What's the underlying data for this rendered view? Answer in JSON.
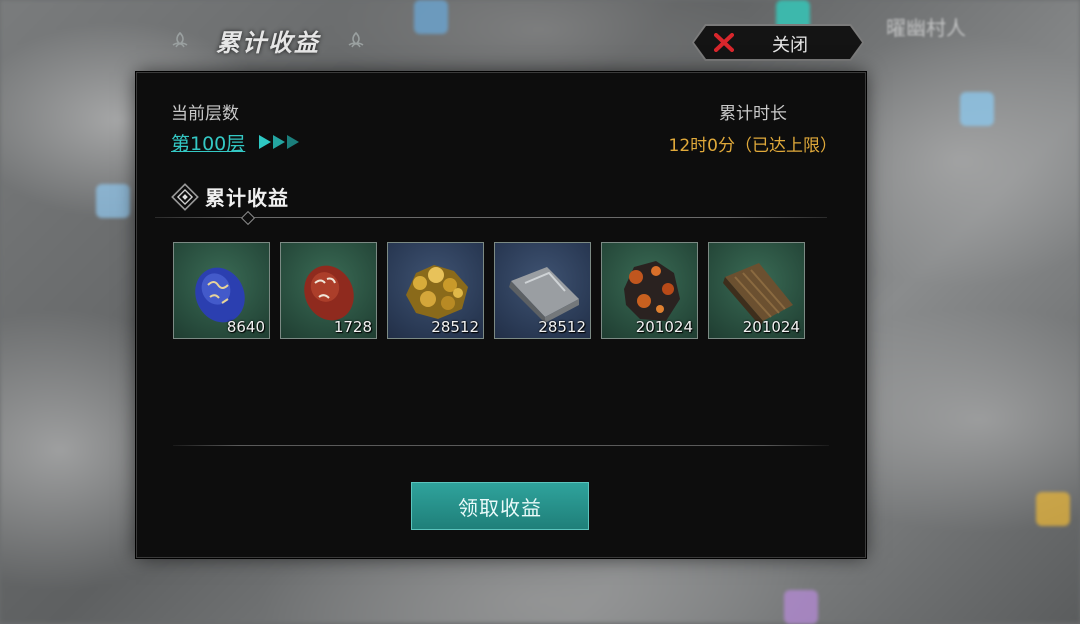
{
  "header": {
    "title": "累计收益",
    "close_label": "关闭"
  },
  "background": {
    "map_labels": [
      "曜幽村人"
    ]
  },
  "info": {
    "floor_label": "当前层数",
    "floor_value": "第100层",
    "duration_label": "累计时长",
    "duration_value": "12时0分（已达上限）"
  },
  "rewards": {
    "section_title": "累计收益",
    "items": [
      {
        "icon": "blue-rune-stone-icon",
        "count": "8640",
        "rarity_color": "#274b3c"
      },
      {
        "icon": "red-rune-stone-icon",
        "count": "1728",
        "rarity_color": "#274b3c"
      },
      {
        "icon": "gold-ore-icon",
        "count": "28512",
        "rarity_color": "#2a3a55"
      },
      {
        "icon": "iron-ingot-icon",
        "count": "28512",
        "rarity_color": "#2a3a55"
      },
      {
        "icon": "copper-ore-icon",
        "count": "201024",
        "rarity_color": "#274b3c"
      },
      {
        "icon": "wood-plank-icon",
        "count": "201024",
        "rarity_color": "#274b3c"
      }
    ]
  },
  "actions": {
    "claim_label": "领取收益"
  },
  "colors": {
    "accent_teal": "#34c8c4",
    "duration_gold": "#e0a93a",
    "button_teal": "#2fa39c"
  }
}
